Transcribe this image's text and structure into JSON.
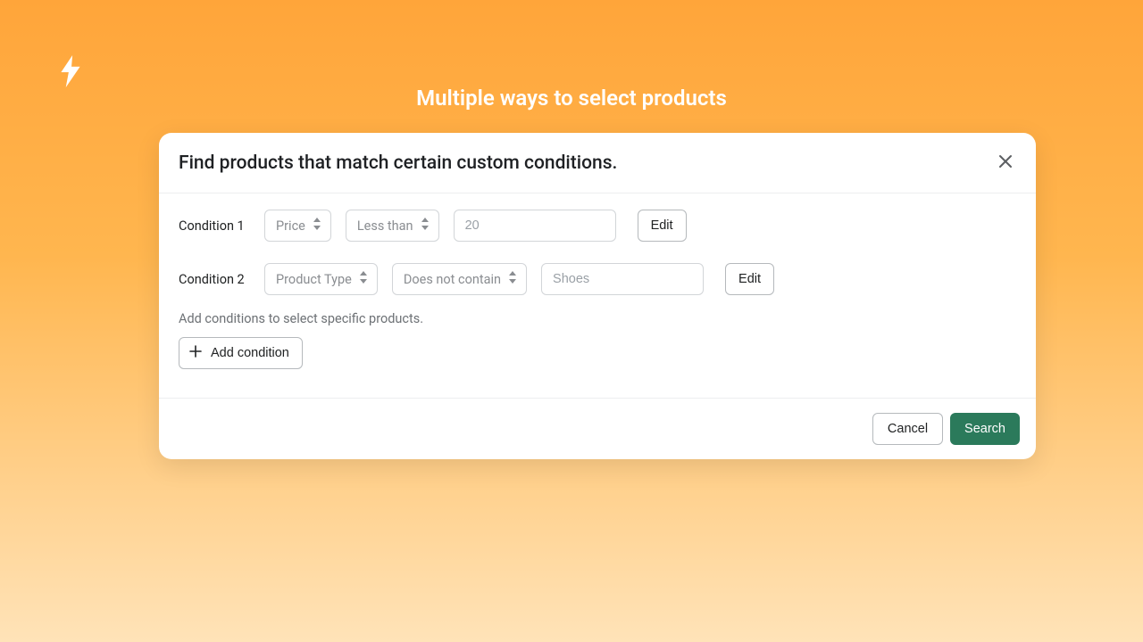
{
  "page": {
    "title": "Multiple ways to select products"
  },
  "modal": {
    "title": "Find products that match certain custom conditions.",
    "helper_text": "Add conditions to select specific products.",
    "add_condition_label": "Add condition",
    "cancel_label": "Cancel",
    "search_label": "Search",
    "conditions": [
      {
        "label": "Condition 1",
        "field": "Price",
        "operator": "Less than",
        "value_placeholder": "20",
        "edit_label": "Edit"
      },
      {
        "label": "Condition 2",
        "field": "Product Type",
        "operator": "Does not contain",
        "value_placeholder": "Shoes",
        "edit_label": "Edit"
      }
    ]
  },
  "colors": {
    "accent": "#2b7a5b",
    "bg_top": "#ffa53a",
    "bg_bottom": "#ffe3b8"
  }
}
